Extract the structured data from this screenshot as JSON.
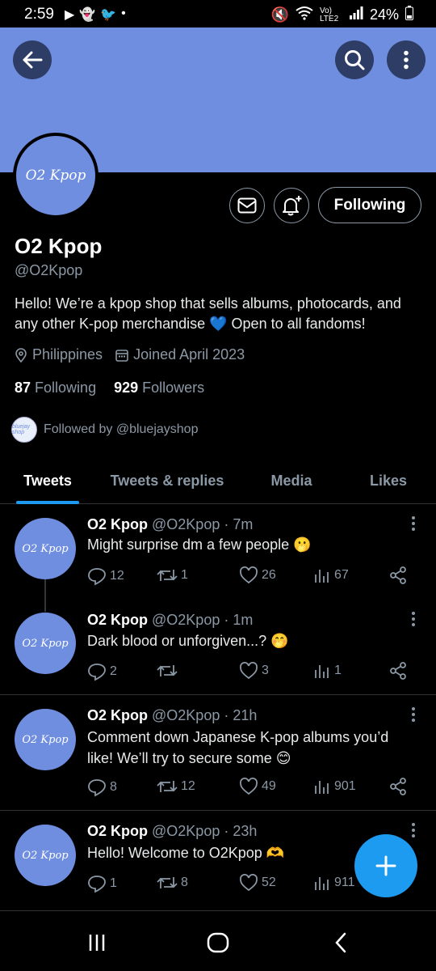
{
  "status": {
    "time": "2:59",
    "left_icons": [
      "youtube-icon",
      "snapchat-icon",
      "twitter-icon",
      "dot-icon"
    ],
    "network": "Vo) LTE2",
    "battery": "24%"
  },
  "colors": {
    "banner": "#6f8ee0",
    "accent": "#1d9bf0",
    "muted": "#8b98a5"
  },
  "profile": {
    "avatar_text": "O2 Kpop",
    "following_label": "Following",
    "name": "O2 Kpop",
    "handle": "@O2Kpop",
    "bio": "Hello! We’re a kpop shop that sells albums, photocards, and any other K-pop merchandise 💙 Open to all fandoms!",
    "location": "Philippines",
    "joined": "Joined April 2023",
    "following_count": "87",
    "following_label2": "Following",
    "followers_count": "929",
    "followers_label": "Followers",
    "followed_by": "Followed by @bluejayshop",
    "mini_avatar_text": "bluejay shop"
  },
  "tabs": [
    "Tweets",
    "Tweets & replies",
    "Media",
    "Likes"
  ],
  "tweets": [
    {
      "name": "O2 Kpop",
      "handle": "@O2Kpop · 7m",
      "text": "Might surprise dm a few people 🫢",
      "replies": "12",
      "retweets": "1",
      "likes": "26",
      "views": "67"
    },
    {
      "name": "O2 Kpop",
      "handle": "@O2Kpop · 1m",
      "text": "Dark blood or unforgiven...? 🤭",
      "replies": "2",
      "retweets": "",
      "likes": "3",
      "views": "1"
    },
    {
      "name": "O2 Kpop",
      "handle": "@O2Kpop · 21h",
      "text": "Comment down Japanese K-pop albums you’d like! We’ll try to secure some 😊",
      "replies": "8",
      "retweets": "12",
      "likes": "49",
      "views": "901"
    },
    {
      "name": "O2 Kpop",
      "handle": "@O2Kpop · 23h",
      "text": "Hello! Welcome to O2Kpop 🫶",
      "replies": "1",
      "retweets": "8",
      "likes": "52",
      "views": "911"
    }
  ]
}
